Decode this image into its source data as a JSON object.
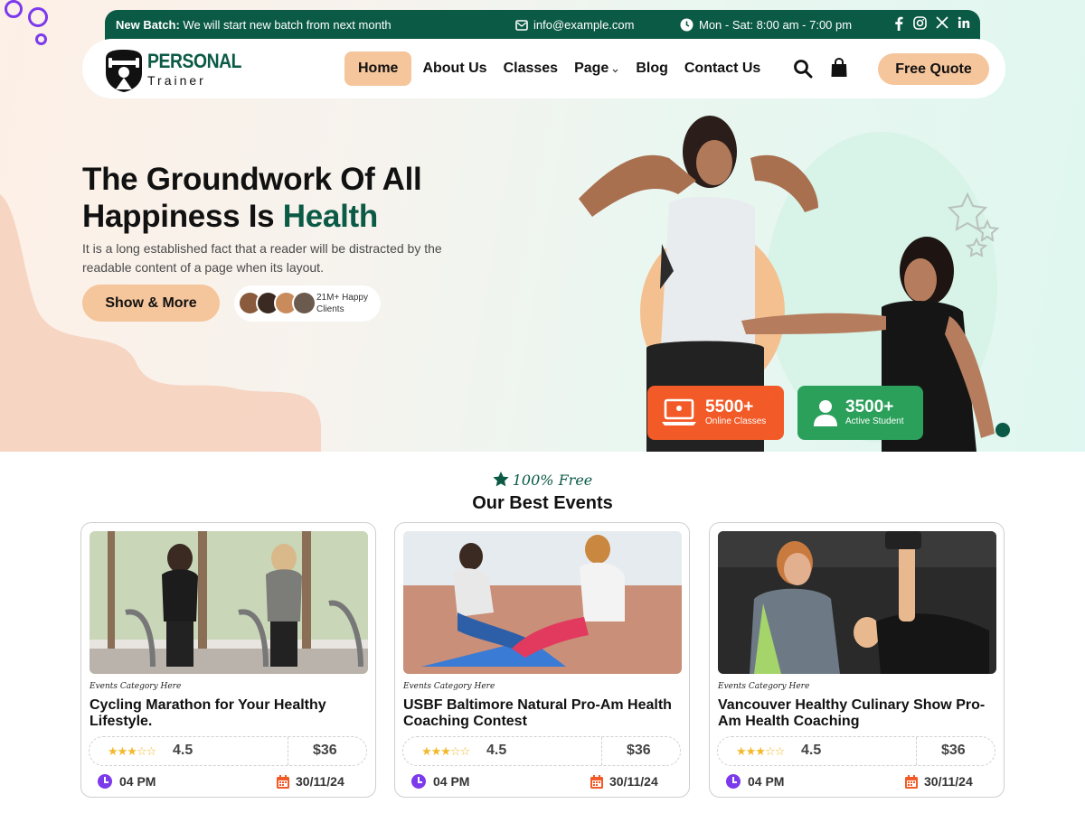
{
  "topbar": {
    "batch_label": "New Batch:",
    "batch_text": "We will start new batch from next month",
    "email": "info@example.com",
    "hours": "Mon - Sat: 8:00 am - 7:00 pm",
    "social": [
      "f",
      "ig",
      "x",
      "in"
    ]
  },
  "logo": {
    "line1": "PERSONAL",
    "line2": "Trainer"
  },
  "nav": {
    "items": [
      {
        "label": "Home",
        "active": true
      },
      {
        "label": "About Us"
      },
      {
        "label": "Classes"
      },
      {
        "label": "Page"
      },
      {
        "label": "Blog"
      },
      {
        "label": "Contact Us"
      }
    ],
    "quote_button": "Free Quote"
  },
  "hero": {
    "title_line1": "The Groundwork Of All",
    "title_line2": "Happiness Is",
    "title_accent": "Health",
    "description": "It is a long established fact that a reader will be distracted by the readable content of a page when its layout.",
    "cta": "Show & More",
    "clients_text": "21M+ Happy Clients"
  },
  "stats": [
    {
      "number": "5500+",
      "label": "Online Classes",
      "color": "#f25a27"
    },
    {
      "number": "3500+",
      "label": "Active Student",
      "color": "#2aa05a"
    }
  ],
  "events": {
    "subtitle": "100% Free",
    "title": "Our Best Events",
    "cards": [
      {
        "category": "Events Category Here",
        "title": "Cycling Marathon for Your Healthy Lifestyle.",
        "rating": "4.5",
        "price": "$36",
        "time": "04 PM",
        "date": "30/11/24"
      },
      {
        "category": "Events Category Here",
        "title": "USBF Baltimore Natural Pro-Am Health Coaching Contest",
        "rating": "4.5",
        "price": "$36",
        "time": "04 PM",
        "date": "30/11/24"
      },
      {
        "category": "Events Category Here",
        "title": "Vancouver Healthy Culinary Show Pro-Am Health Coaching",
        "rating": "4.5",
        "price": "$36",
        "time": "04 PM",
        "date": "30/11/24"
      }
    ]
  },
  "colors": {
    "brand": "#0b5a45",
    "accent": "#f5c59b",
    "purple": "#7c3aed"
  }
}
